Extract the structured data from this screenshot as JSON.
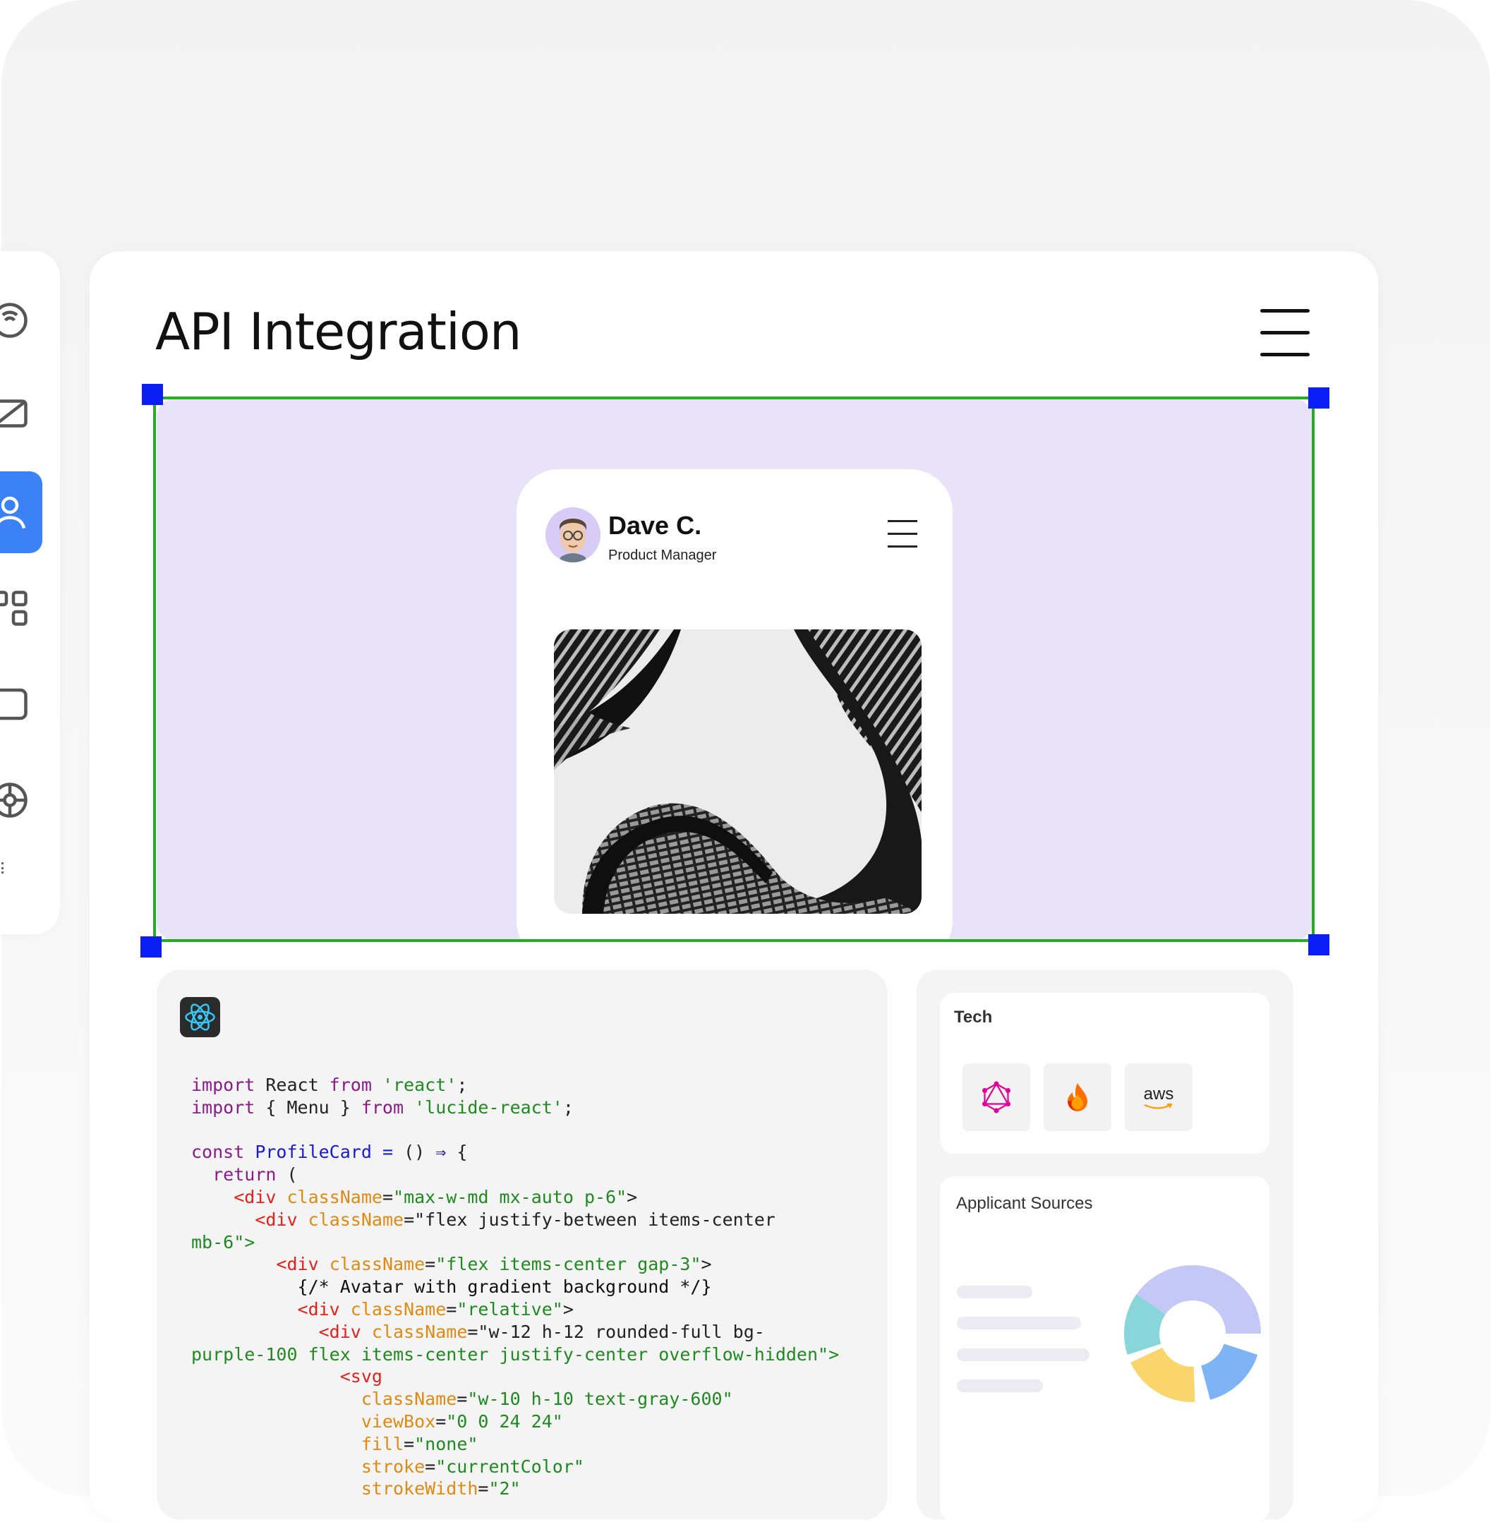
{
  "page": {
    "title": "API Integration"
  },
  "sidebar": {
    "items": [
      {
        "icon": "dashboard-icon",
        "active": false
      },
      {
        "icon": "mail-icon",
        "active": false
      },
      {
        "icon": "user-icon",
        "active": true
      },
      {
        "icon": "apps-icon",
        "active": false
      },
      {
        "icon": "square-icon",
        "active": false
      },
      {
        "icon": "settings-icon",
        "active": false
      }
    ],
    "active_color": "#3b82f6"
  },
  "preview": {
    "background": "#e9e3f9",
    "profile": {
      "name": "Dave C.",
      "role": "Product Manager"
    },
    "selection_color": "#22b022",
    "handle_color": "#0a1ff5"
  },
  "code": {
    "language": "react-jsx",
    "lines": [
      "import React from 'react';",
      "import { Menu } from 'lucide-react';",
      "",
      "const ProfileCard = () ⇒ {",
      "  return (",
      "    <div className=\"max-w-md mx-auto p-6\">",
      "      <div className=\"flex justify-between items-center",
      "mb-6\">",
      "        <div className=\"flex items-center gap-3\">",
      "          {/* Avatar with gradient background */}",
      "          <div className=\"relative\">",
      "            <div className=\"w-12 h-12 rounded-full bg-",
      "purple-100 flex items-center justify-center overflow-hidden\">",
      "              <svg",
      "                className=\"w-10 h-10 text-gray-600\"",
      "                viewBox=\"0 0 24 24\"",
      "                fill=\"none\"",
      "                stroke=\"currentColor\"",
      "                strokeWidth=\"2\""
    ]
  },
  "tech": {
    "title": "Tech",
    "items": [
      {
        "name": "graphql-icon"
      },
      {
        "name": "firebase-icon"
      },
      {
        "name": "aws-icon",
        "label": "aws"
      }
    ]
  },
  "applicant_sources": {
    "title": "Applicant Sources",
    "colors": [
      "#c5c8f6",
      "#88d6d9",
      "#f9d56c",
      "#7eb3f5"
    ]
  }
}
